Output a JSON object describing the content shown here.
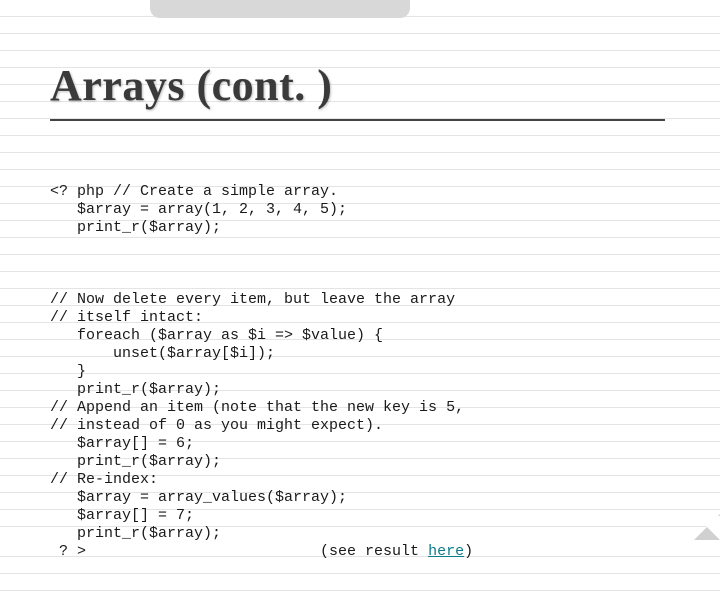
{
  "slide": {
    "title": "Arrays (cont. )",
    "code_block1": "<? php // Create a simple array.\n   $array = array(1, 2, 3, 4, 5);\n   print_r($array);",
    "code_block2": "// Now delete every item, but leave the array\n// itself intact:\n   foreach ($array as $i => $value) {\n       unset($array[$i]);\n   }\n   print_r($array);\n// Append an item (note that the new key is 5,\n// instead of 0 as you might expect).\n   $array[] = 6;\n   print_r($array);\n// Re-index:\n   $array = array_values($array);\n   $array[] = 7;\n   print_r($array);\n ? >                          (see result ",
    "link_text": "here",
    "code_tail": ")"
  }
}
